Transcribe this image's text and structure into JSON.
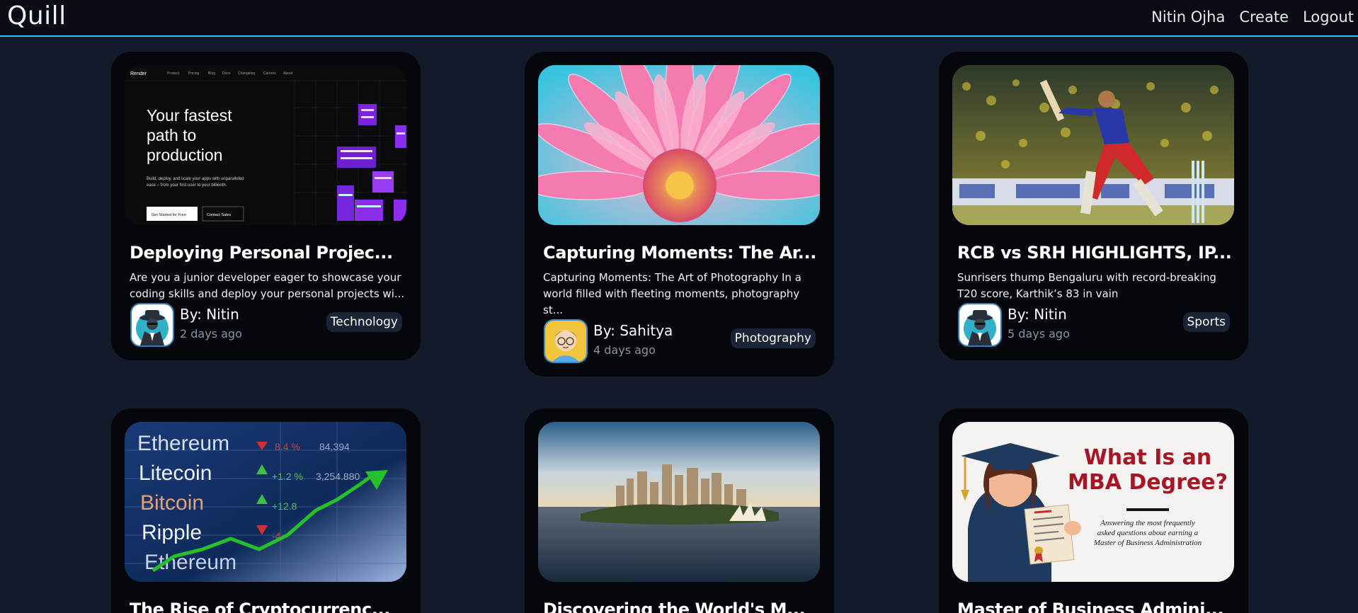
{
  "nav": {
    "brand": "Quill",
    "links": [
      "Nitin Ojha",
      "Create",
      "Logout"
    ]
  },
  "posts": [
    {
      "title": "Deploying Personal Projec...",
      "excerpt": "Are you a junior developer eager to showcase your coding skills and deploy your personal projects wi...",
      "author": "By: Nitin",
      "time": "2 days ago",
      "category": "Technology",
      "thumbnail": {
        "nav_brand": "Render",
        "nav_items": [
          "Product",
          "Pricing",
          "Blog",
          "Docs",
          "Changelog",
          "Careers",
          "About"
        ],
        "headline": [
          "Your fastest",
          "path to",
          "production"
        ],
        "subtext": [
          "Build, deploy, and scale your apps with unparalleled",
          "ease – from your first user to your billionth."
        ],
        "primary_cta": "Get Started for Free",
        "secondary_cta": "Contact Sales"
      }
    },
    {
      "title": "Capturing Moments: The Ar...",
      "excerpt": "Capturing Moments: The Art of Photography In a world filled with fleeting moments, photography st...",
      "author": "By: Sahitya",
      "time": "4 days ago",
      "category": "Photography"
    },
    {
      "title": "RCB vs SRH HIGHLIGHTS, IP...",
      "excerpt": "Sunrisers thump Bengaluru with record-breaking T20 score, Karthik’s 83 in vain",
      "author": "By: Nitin",
      "time": "5 days ago",
      "category": "Sports"
    },
    {
      "title": "The Rise of Cryptocurrenc...",
      "thumbnail": {
        "coins": [
          "Ethereum",
          "Litecoin",
          "Bitcoin",
          "Ripple",
          "Ethereum"
        ],
        "changes": [
          "8.4 %",
          "+1.2 %",
          "+12.8",
          "-4"
        ],
        "prices": [
          "84,394",
          "3,254.880"
        ]
      }
    },
    {
      "title": "Discovering the World's M..."
    },
    {
      "title": "Master of Business Admini...",
      "thumbnail": {
        "heading": [
          "What Is an",
          "MBA Degree?"
        ],
        "caption": [
          "Answering the most frequently",
          "asked questions about earning a",
          "Master of Business Administration"
        ]
      }
    }
  ],
  "colors": {
    "background": "#131a2a",
    "navbar": "#090c14",
    "accent": "#38bdf8",
    "card": "#05070d",
    "tag": "#1a2436"
  }
}
